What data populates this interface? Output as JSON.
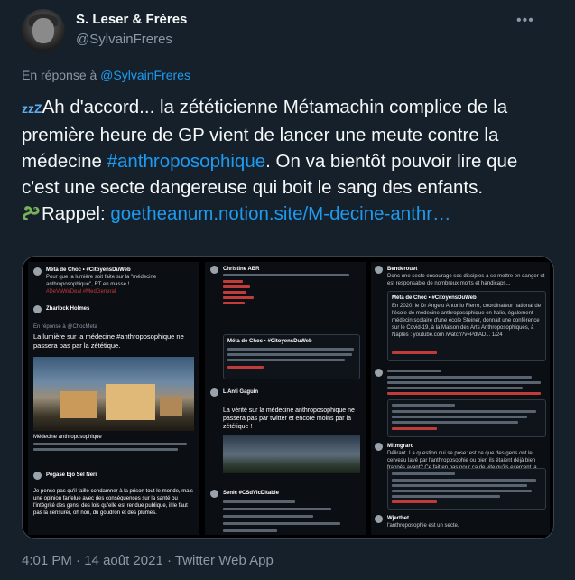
{
  "author": {
    "display_name": "S. Leser & Frères",
    "handle": "@SylvainFreres"
  },
  "reply": {
    "prefix": "En réponse à ",
    "to": "@SylvainFreres"
  },
  "tweet": {
    "text_part1": "Ah d'accord... la zététicienne Métamachin complice de la première heure de GP vient de lancer une meute contre la médecine ",
    "hashtag": "#anthroposophique",
    "text_part2": ". On va bientôt pouvoir lire que c'est une secte dangereuse qui boit le sang des enfants.",
    "rappel_label": "Rappel: ",
    "link": "goetheanum.notion.site/M-decine-anthr…",
    "zzz": "zzZ"
  },
  "media_text": {
    "p1_name": "Méta de Choc • #CitoyensDuWeb",
    "p1_line": "Pour que la lumière soit faite sur la \"médecine anthroposophique\", RT en masse !",
    "p1_tags": "#DeVaWeDeal #MedGeneral",
    "p1_name2": "Zharlock Holmes",
    "p1_reply": "En réponse à @ChocMeta",
    "p1_big": "La lumière sur la médecine #anthroposophique ne passera pas par la zététique.",
    "p1_caption": "Médecine anthroposophique",
    "p1_name3": "Pegase Ejo Sel Neri",
    "p1_quote": "Je pense pas qu'il faille condamner à la prison tout le monde, mais une opinion farfelue avec des conséquences sur la santé ou l'intégrité des gens, des lois qu'elle est rendue publique, il le faut pas la censurer, oh non, du goudron et des plumes.",
    "p2_name": "Christine ABR",
    "p2_quote_name": "Méta de Choc • #CitoyensDuWeb",
    "p2_name2": "L'Anti Gaguin",
    "p2_big": "La vérité sur la médecine anthroposophique ne passera pas par twitter et encore moins par la zététique !",
    "p2_name3": "Senic #CSdVicDitable",
    "p3_name": "Benderouet",
    "p3_line": "Donc une secte encourage ses disciples à se mettre en danger et est responsable de nombreux morts et handicaps...",
    "p3_quote_name": "Méta de Choc • #CitoyensDuWeb",
    "p3_quote": "En 2020, le Dr Angelo Antonio Fierro, coordinateur national de l'école de médecine anthroposophique en Italie, également médecin scolaire d'une école Steiner, donnait une conférence sur le Covid-19, à la Maison des Arts Anthroposophiques, à Naples : youtube.com /watch?v=PdtAD... 1/24",
    "p3_name2": "Mitmgraro",
    "p3_line2": "Délirant. La question qui se pose: est ce que des gens ont le cerveau lavé par l'anthroposophie ou bien ils étaient déjà bien frappés avant? Ce fait en pas pour ça de vite qu'ils exercent la médecine",
    "p3_name3": "Wjertbet",
    "p3_line3": "l'anthroposophie est un secte."
  },
  "meta": {
    "time": "4:01 PM",
    "date": "14 août 2021",
    "source": "Twitter Web App",
    "separator": " · "
  }
}
